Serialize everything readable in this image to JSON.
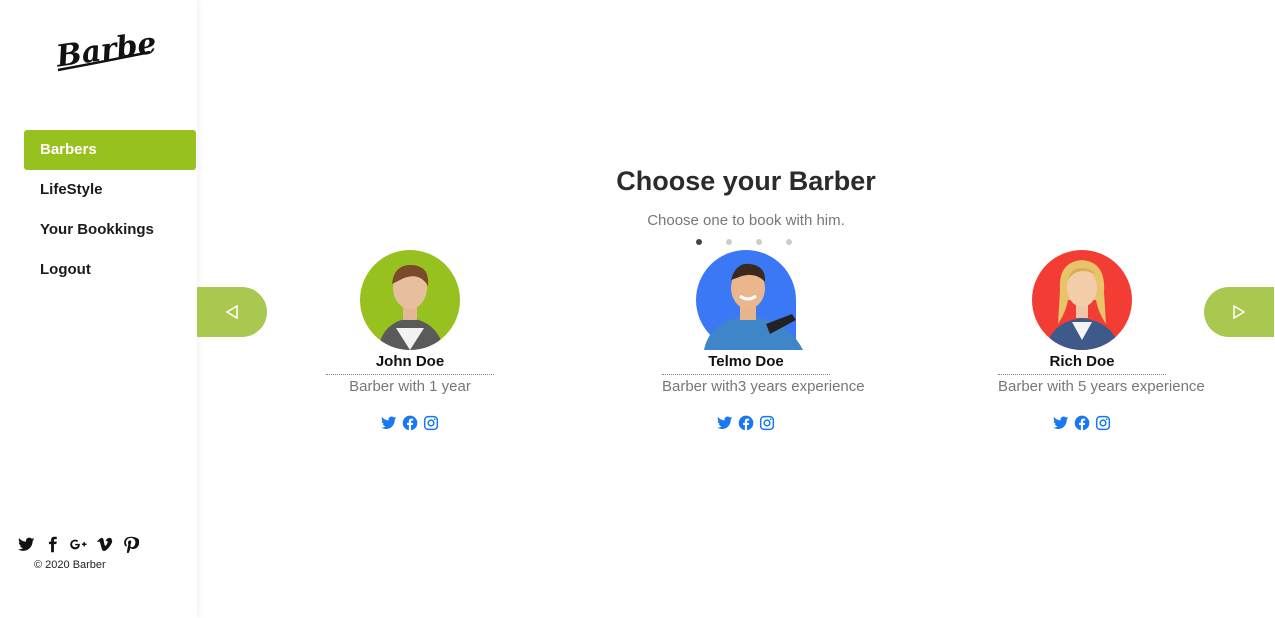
{
  "brand": {
    "logo_text": "Barber"
  },
  "sidebar": {
    "nav": [
      {
        "label": "Barbers",
        "active": true
      },
      {
        "label": "LifeStyle",
        "active": false
      },
      {
        "label": "Your Bookkings",
        "active": false
      },
      {
        "label": "Logout",
        "active": false
      }
    ],
    "social_icons": [
      "twitter-icon",
      "facebook-icon",
      "google-plus-icon",
      "vimeo-icon",
      "pinterest-icon"
    ],
    "copyright": "© 2020 Barber"
  },
  "main": {
    "title": "Choose your Barber",
    "subtitle": "Choose one to book with him.",
    "carousel": {
      "pages": 4,
      "active_page": 1
    },
    "barbers": [
      {
        "name": "John Doe",
        "description": "Barber with 1 year",
        "avatar_bg": "#96c11f"
      },
      {
        "name": "Telmo Doe",
        "description": "Barber with3 years experience",
        "avatar_bg": "#3b78f5"
      },
      {
        "name": "Rich Doe",
        "description": "Barber with 5 years experience",
        "avatar_bg": "#f23c34"
      }
    ],
    "card_social_icons": [
      "twitter-icon",
      "facebook-icon",
      "instagram-icon"
    ]
  },
  "colors": {
    "accent": "#96c11f",
    "arrow": "#a8c84f",
    "social_blue": "#1877f2"
  }
}
